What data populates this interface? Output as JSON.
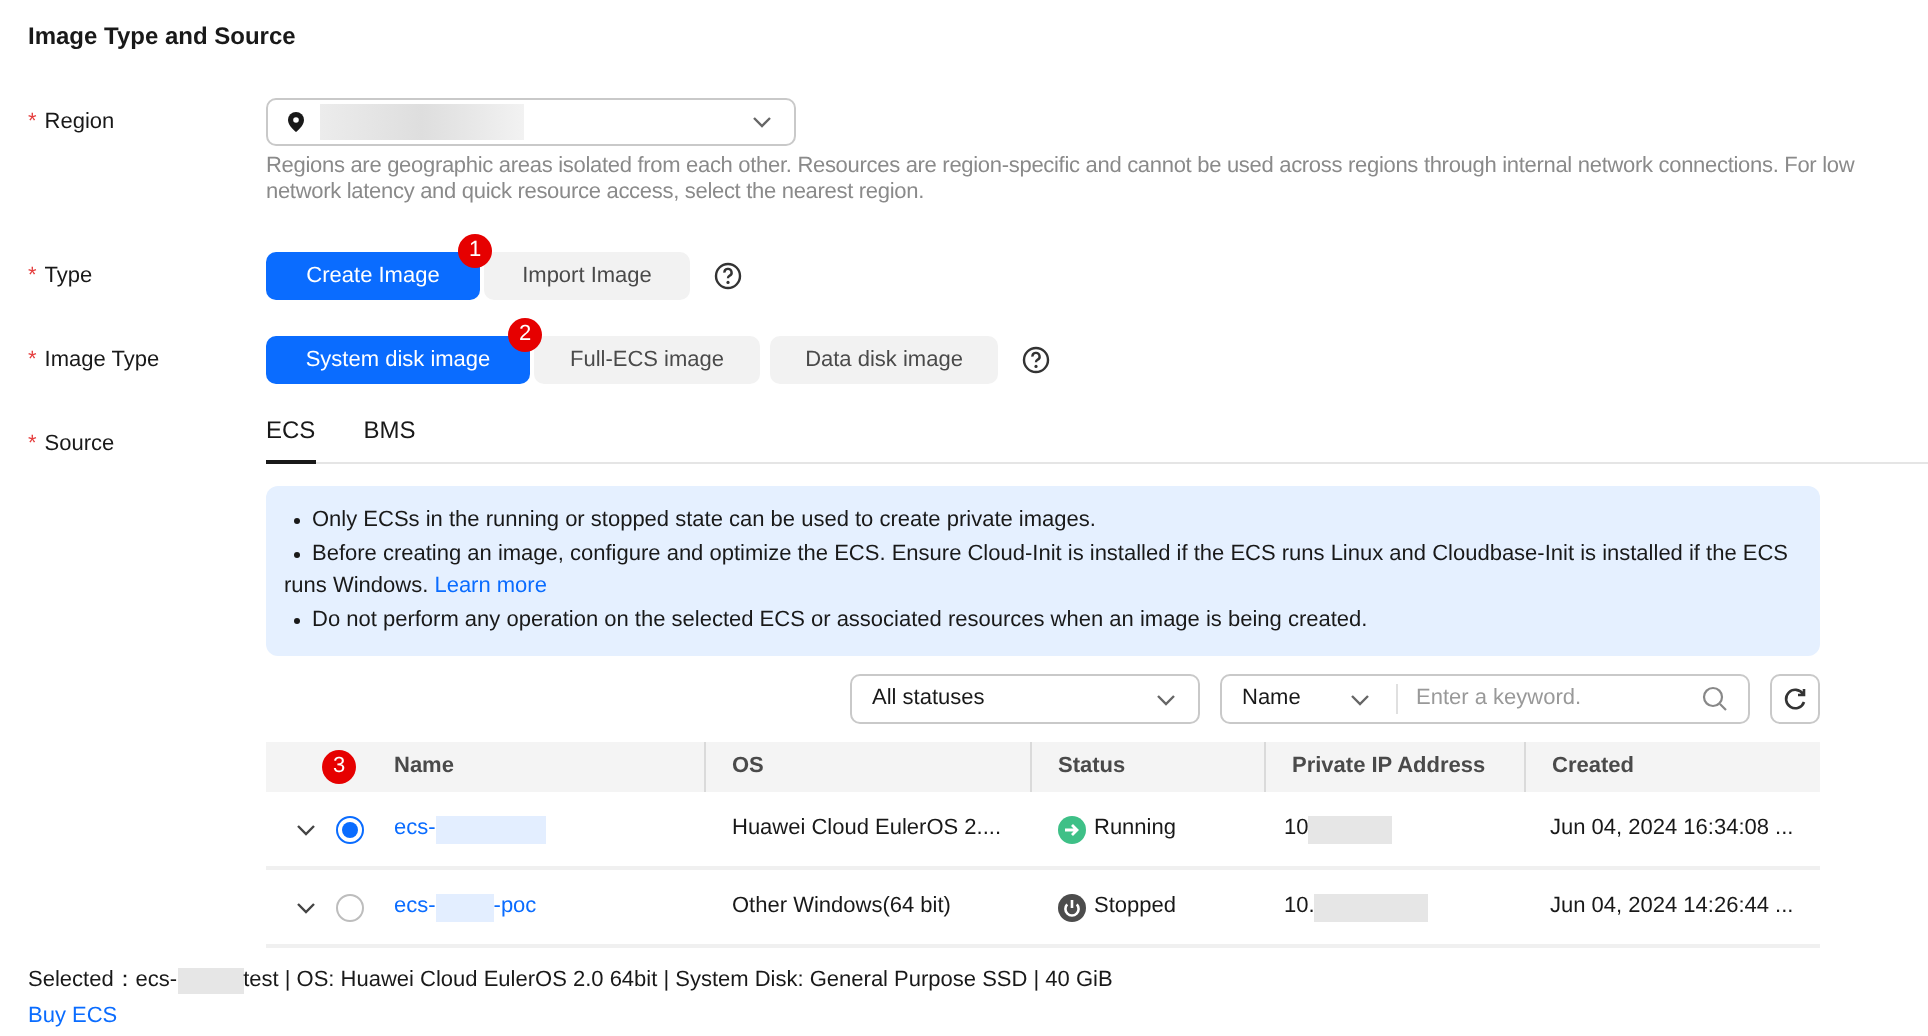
{
  "section_title": "Image Type and Source",
  "region": {
    "label": "Region",
    "required_mark": "*",
    "value": [
      {
        "kind": "redacted"
      }
    ],
    "help": "Regions are geographic areas isolated from each other. Resources are region-specific and cannot be used across regions through internal network connections. For low network latency and quick resource access, select the nearest region."
  },
  "type": {
    "label": "Type",
    "required_mark": "*",
    "options": [
      {
        "label": "Create Image",
        "selected": true,
        "badge": "1"
      },
      {
        "label": "Import Image",
        "selected": false
      }
    ]
  },
  "image_type": {
    "label": "Image Type",
    "required_mark": "*",
    "options": [
      {
        "label": "System disk image",
        "selected": true,
        "badge": "2"
      },
      {
        "label": "Full-ECS image",
        "selected": false
      },
      {
        "label": "Data disk image",
        "selected": false
      }
    ]
  },
  "source": {
    "label": "Source",
    "required_mark": "*",
    "tabs": [
      {
        "label": "ECS",
        "selected": true
      },
      {
        "label": "BMS",
        "selected": false
      }
    ],
    "notes": [
      {
        "text": "Only ECSs in the running or stopped state can be used to create private images."
      },
      {
        "text": "Before creating an image, configure and optimize the ECS. Ensure Cloud-Init is installed if the ECS runs Linux and Cloudbase-Init is installed if the ECS runs Windows.",
        "link": "Learn more"
      },
      {
        "text": "Do not perform any operation on the selected ECS or associated resources when an image is being created."
      }
    ],
    "status_filter": "All statuses",
    "search_by": "Name",
    "search": {
      "placeholder": "Enter a keyword."
    },
    "table": {
      "badge": "3",
      "columns": [
        "Name",
        "OS",
        "Status",
        "Private IP Address",
        "Created"
      ],
      "rows": [
        {
          "selected": true,
          "name": [
            {
              "kind": "text",
              "text": "ecs-"
            },
            {
              "kind": "redacted"
            }
          ],
          "os": "Huawei Cloud EulerOS 2....",
          "status": {
            "kind": "running",
            "text": "Running"
          },
          "ip": [
            {
              "kind": "text",
              "text": "10"
            },
            {
              "kind": "redacted"
            }
          ],
          "created": "Jun 04, 2024 16:34:08 ..."
        },
        {
          "selected": false,
          "name": [
            {
              "kind": "text",
              "text": "ecs-"
            },
            {
              "kind": "redacted"
            },
            {
              "kind": "text",
              "text": "-poc"
            }
          ],
          "os": "Other Windows(64 bit)",
          "status": {
            "kind": "stopped",
            "text": "Stopped"
          },
          "ip": [
            {
              "kind": "text",
              "text": "10."
            },
            {
              "kind": "redacted"
            }
          ],
          "created": "Jun 04, 2024 14:26:44 ..."
        }
      ]
    },
    "summary": [
      {
        "kind": "text",
        "text": "Selected：ecs-"
      },
      {
        "kind": "redacted"
      },
      {
        "kind": "text",
        "text": "test | OS: Huawei Cloud EulerOS 2.0 64bit | System Disk: General Purpose SSD | 40 GiB"
      }
    ],
    "buy_link": "Buy ECS"
  }
}
